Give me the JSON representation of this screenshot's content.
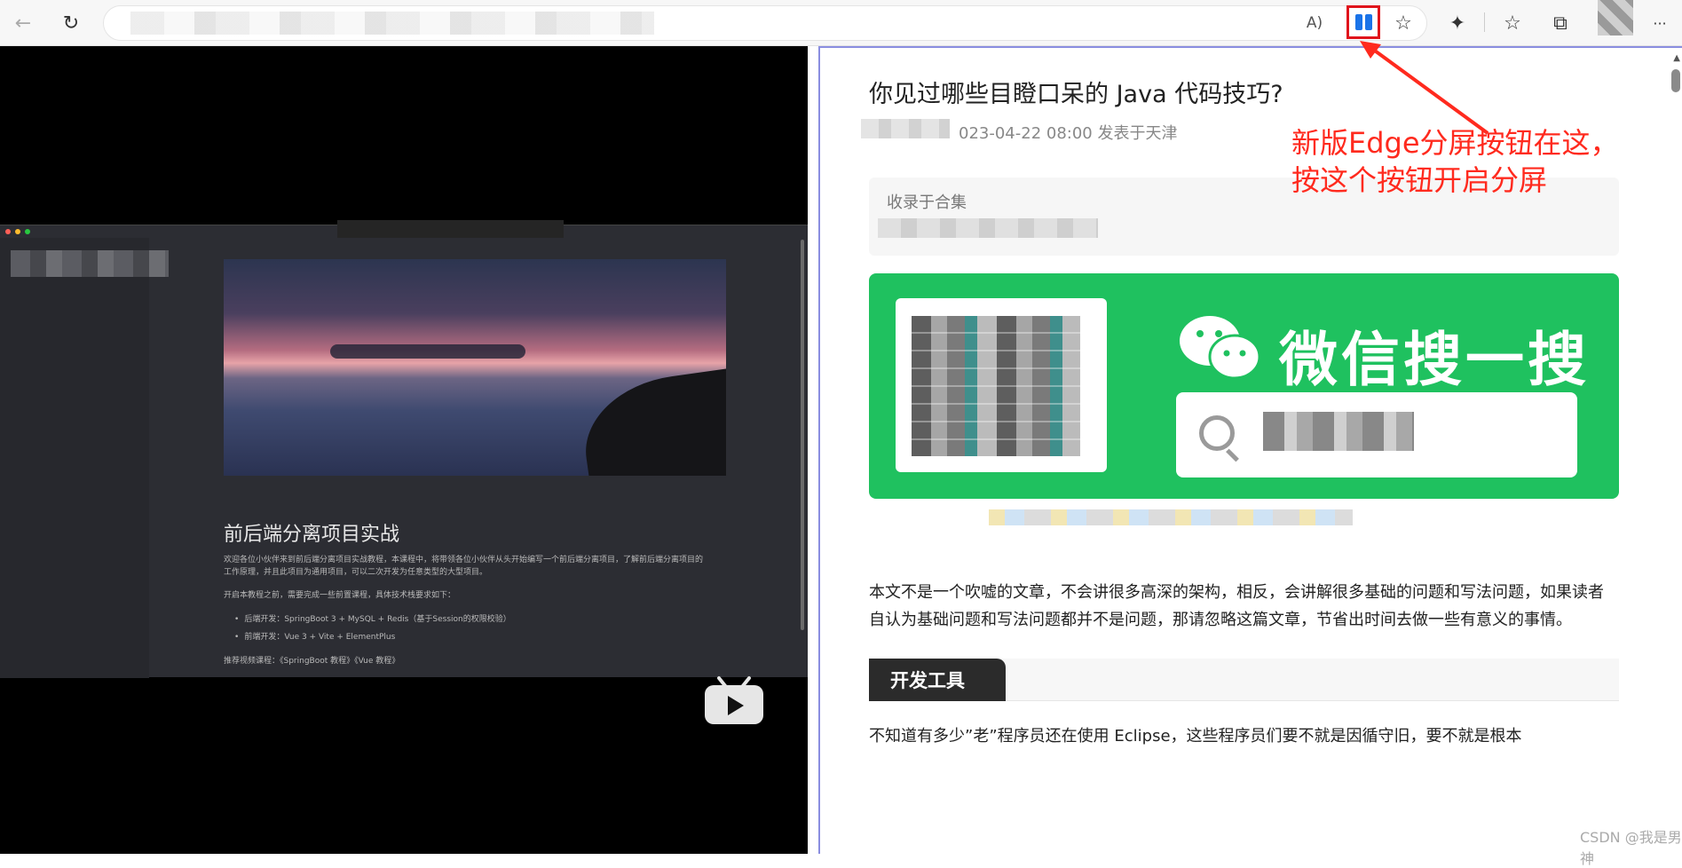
{
  "toolbar": {
    "back_icon": "←",
    "reload_icon": "↻",
    "read_aloud_icon": "A)",
    "favorite_add_icon": "☆",
    "extensions_icon": "✦",
    "favorites_icon": "☆",
    "collections_icon": "⧉",
    "more_icon": "···"
  },
  "left_pane": {
    "heading": "前后端分离项目实战",
    "para1_line1": "欢迎各位小伙伴来到前后端分离项目实战教程，本课程中，将带领各位小伙伴从头开始编写一个前后端分离项目，了解前后端分离项目的",
    "para1_line2": "工作原理，并且此项目为通用项目，可以二次开发为任意类型的大型项目。",
    "para2": "开启本教程之前，需要完成一些前置课程，具体技术栈要求如下：",
    "list_items": [
      "后端开发：SpringBoot 3 + MySQL + Redis（基于Session的权限校验）",
      "前端开发：Vue 3 + Vite + ElementPlus"
    ],
    "recommend": "推荐视频课程：《SpringBoot 教程》《Vue 教程》",
    "dots_colors": [
      "#ff5f57",
      "#febc2e",
      "#28c840"
    ]
  },
  "article": {
    "title": "你见过哪些目瞪口呆的 Java 代码技巧?",
    "meta": "023-04-22 08:00   发表于天津",
    "collection_label": "收录于合集",
    "wechat_text": "微信搜一搜",
    "intro": "本文不是一个吹嘘的文章，不会讲很多高深的架构，相反，会讲解很多基础的问题和写法问题，如果读者自认为基础问题和写法问题都并不是问题，那请忽略这篇文章，节省出时间去做一些有意义的事情。",
    "section_heading": "开发工具",
    "para_after": "不知道有多少”老”程序员还在使用 Eclipse，这些程序员们要不就是因循守旧，要不就是根本"
  },
  "annotation": {
    "line1": "新版Edge分屏按钮在这，",
    "line2": "按这个按钮开启分屏",
    "color": "#ff2a1e"
  },
  "watermark": "CSDN @我是男神"
}
